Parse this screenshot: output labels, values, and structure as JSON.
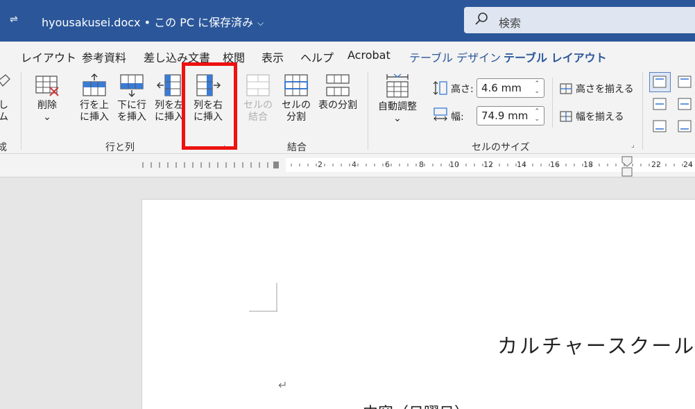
{
  "titlebar": {
    "doc_title": "hyousakusei.docx • この PC に保存済み",
    "chevron": "⌵",
    "search_placeholder": "検索"
  },
  "tabs": [
    {
      "label": "レイアウト"
    },
    {
      "label": "参考資料"
    },
    {
      "label": "差し込み文書"
    },
    {
      "label": "校閲"
    },
    {
      "label": "表示"
    },
    {
      "label": "ヘルプ"
    },
    {
      "label": "Acrobat"
    },
    {
      "label": "テーブル デザイン"
    },
    {
      "label": "テーブル レイアウト"
    }
  ],
  "ribbon": {
    "partial_left": {
      "line1": "し",
      "line2": "ム",
      "group": "成"
    },
    "rows_cols": {
      "delete": {
        "line1": "削除",
        "line2": "⌄"
      },
      "insert_above": {
        "line1": "行を上",
        "line2": "に挿入"
      },
      "insert_below": {
        "line1": "下に行",
        "line2": "を挿入"
      },
      "insert_left": {
        "line1": "列を左",
        "line2": "に挿入"
      },
      "insert_right": {
        "line1": "列を右",
        "line2": "に挿入"
      },
      "group_label": "行と列"
    },
    "merge": {
      "merge_cells": {
        "line1": "セルの",
        "line2": "結合"
      },
      "split_cells": {
        "line1": "セルの",
        "line2": "分割"
      },
      "split_table": {
        "line1": "表の分割"
      },
      "group_label": "結合"
    },
    "cell_size": {
      "autofit": {
        "line1": "自動調整",
        "line2": "⌄"
      },
      "height_label": "高さ:",
      "height_value": "4.6 mm",
      "width_label": "幅:",
      "width_value": "74.9 mm",
      "distribute_rows": "高さを揃える",
      "distribute_cols": "幅を揃える",
      "group_label": "セルのサイズ"
    }
  },
  "ruler": {
    "labels": [
      "2",
      "4",
      "6",
      "8",
      "10",
      "12",
      "14",
      "16",
      "18",
      "22",
      "24"
    ]
  },
  "document": {
    "heading": "カルチャースクール",
    "paragraph_mark": "↵",
    "line2": "…中容（日曜日）"
  },
  "colors": {
    "title_bar": "#2b579a",
    "accent": "#2b579a",
    "highlight": "#ee1111",
    "icon_blue": "#3a7bd5",
    "icon_red": "#d13438"
  }
}
